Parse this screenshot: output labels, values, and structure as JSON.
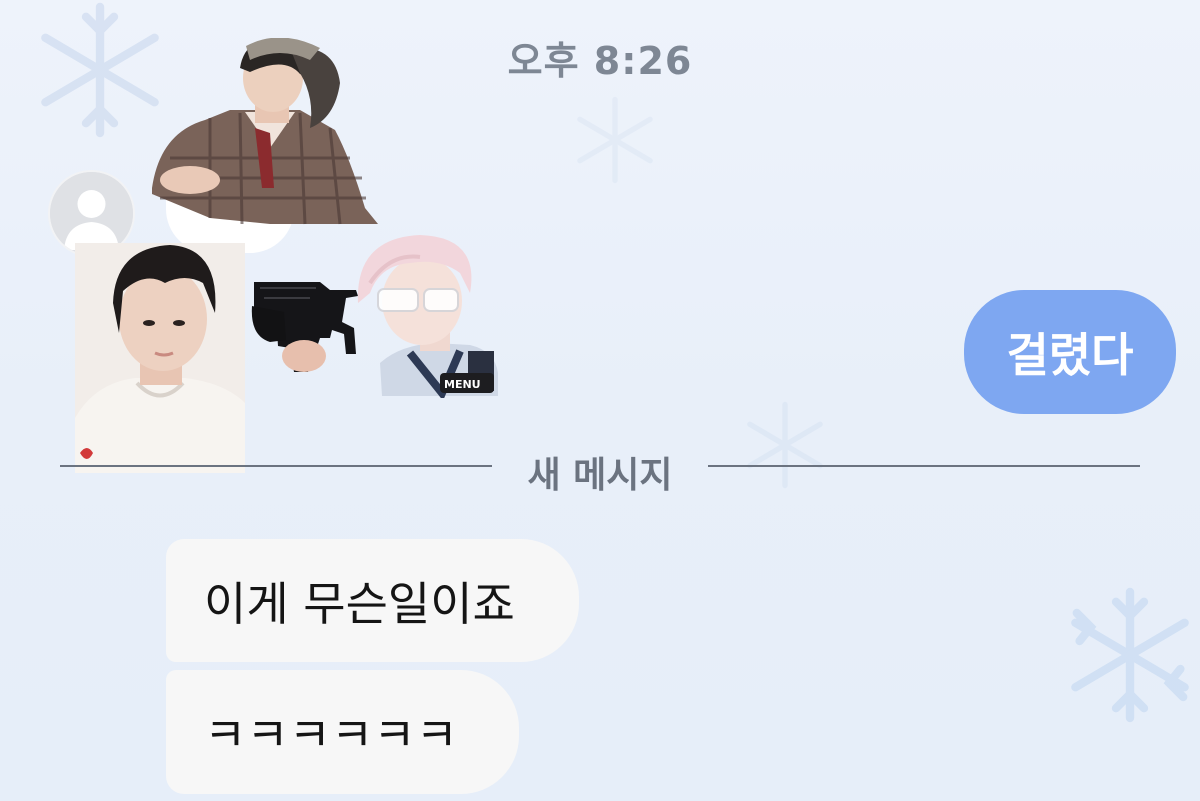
{
  "chat": {
    "timestamp": "오후 8:26",
    "typing_indicator": "··",
    "sent_message": "걸렸다",
    "new_messages_divider": "새 메시지",
    "received_messages": [
      "이게 무슨일이죠",
      "ㅋㅋㅋㅋㅋㅋ"
    ]
  },
  "colors": {
    "background": "#e9f0fa",
    "sent_bubble": "#7ea7f1",
    "received_bubble": "#f7f7f7",
    "timestamp_text": "#7e8794",
    "divider": "#6b7380"
  },
  "icons": {
    "avatar": "default-person-avatar-icon",
    "background_pattern": "snowflake-icon"
  },
  "sticker_labels": {
    "menu_button": "MENU"
  }
}
